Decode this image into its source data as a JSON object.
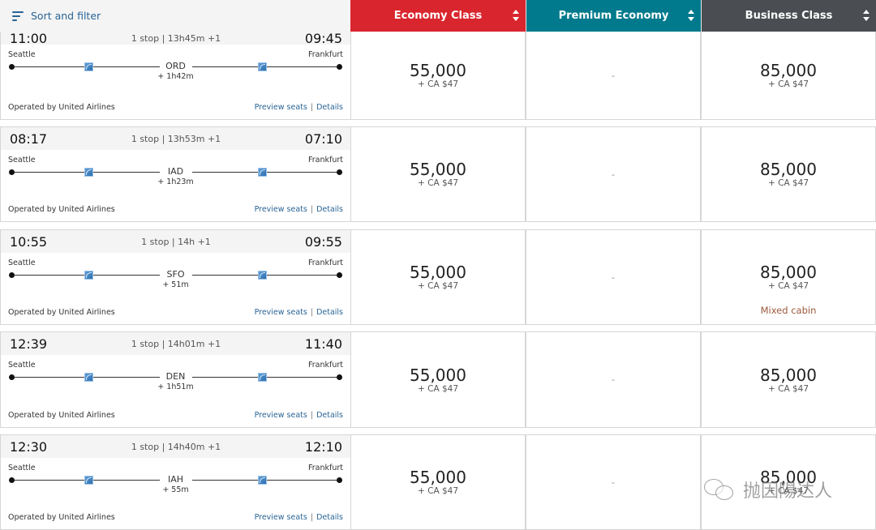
{
  "header": {
    "sort_filter_label": "Sort and filter",
    "columns": [
      {
        "label": "Economy Class",
        "color": "#d9262e"
      },
      {
        "label": "Premium Economy",
        "color": "#007a8c"
      },
      {
        "label": "Business Class",
        "color": "#4a4e52"
      }
    ]
  },
  "flights": [
    {
      "depart": "11:00",
      "arrive": "09:45",
      "summary": "1 stop | 13h45m +1",
      "origin": "Seattle",
      "destination": "Frankfurt",
      "stop": "ORD",
      "layover": "+ 1h42m",
      "operated_by": "Operated by United Airlines",
      "preview_seats": "Preview seats",
      "details": "Details",
      "economy": {
        "miles": "55,000",
        "tax": "+ CA $47"
      },
      "premium": {
        "text": "-"
      },
      "business": {
        "miles": "85,000",
        "tax": "+ CA $47",
        "note": ""
      }
    },
    {
      "depart": "08:17",
      "arrive": "07:10",
      "summary": "1 stop | 13h53m +1",
      "origin": "Seattle",
      "destination": "Frankfurt",
      "stop": "IAD",
      "layover": "+ 1h23m",
      "operated_by": "Operated by United Airlines",
      "preview_seats": "Preview seats",
      "details": "Details",
      "economy": {
        "miles": "55,000",
        "tax": "+ CA $47"
      },
      "premium": {
        "text": "-"
      },
      "business": {
        "miles": "85,000",
        "tax": "+ CA $47",
        "note": ""
      }
    },
    {
      "depart": "10:55",
      "arrive": "09:55",
      "summary": "1 stop | 14h +1",
      "origin": "Seattle",
      "destination": "Frankfurt",
      "stop": "SFO",
      "layover": "+ 51m",
      "operated_by": "Operated by United Airlines",
      "preview_seats": "Preview seats",
      "details": "Details",
      "economy": {
        "miles": "55,000",
        "tax": "+ CA $47"
      },
      "premium": {
        "text": "-"
      },
      "business": {
        "miles": "85,000",
        "tax": "+ CA $47",
        "note": "Mixed cabin"
      }
    },
    {
      "depart": "12:39",
      "arrive": "11:40",
      "summary": "1 stop | 14h01m +1",
      "origin": "Seattle",
      "destination": "Frankfurt",
      "stop": "DEN",
      "layover": "+ 1h51m",
      "operated_by": "Operated by United Airlines",
      "preview_seats": "Preview seats",
      "details": "Details",
      "economy": {
        "miles": "55,000",
        "tax": "+ CA $47"
      },
      "premium": {
        "text": "-"
      },
      "business": {
        "miles": "85,000",
        "tax": "+ CA $47",
        "note": ""
      }
    },
    {
      "depart": "12:30",
      "arrive": "12:10",
      "summary": "1 stop | 14h40m +1",
      "origin": "Seattle",
      "destination": "Frankfurt",
      "stop": "IAH",
      "layover": "+ 55m",
      "operated_by": "Operated by United Airlines",
      "preview_seats": "Preview seats",
      "details": "Details",
      "economy": {
        "miles": "55,000",
        "tax": "+ CA $47"
      },
      "premium": {
        "text": "-"
      },
      "business": {
        "miles": "85,000",
        "tax": "+ CA $47",
        "note": ""
      }
    }
  ],
  "watermark": {
    "text": "抛因陽达人",
    "icon": "wechat-icon"
  }
}
